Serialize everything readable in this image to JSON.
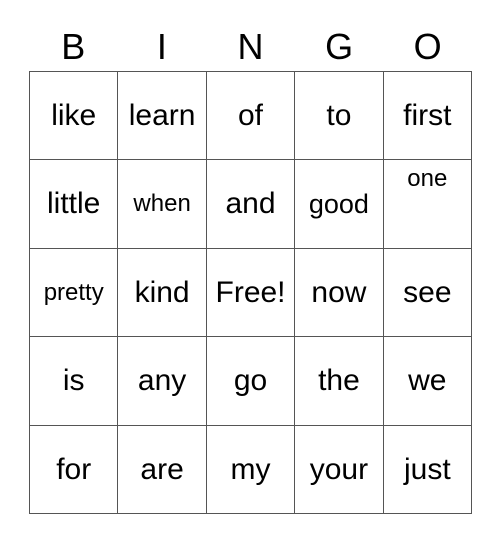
{
  "card": {
    "title": "BINGO",
    "headers": [
      "B",
      "I",
      "N",
      "G",
      "O"
    ],
    "free_space_label": "Free!",
    "grid_line_color": "#555555",
    "background_color": "#ffffff",
    "text_color": "#000000",
    "rows": 5,
    "columns": 5,
    "cells": [
      [
        {
          "text": "like",
          "size": "normal",
          "valign": "middle"
        },
        {
          "text": "learn",
          "size": "normal",
          "valign": "middle"
        },
        {
          "text": "of",
          "size": "normal",
          "valign": "middle"
        },
        {
          "text": "to",
          "size": "normal",
          "valign": "middle"
        },
        {
          "text": "first",
          "size": "normal",
          "valign": "middle"
        }
      ],
      [
        {
          "text": "little",
          "size": "normal",
          "valign": "middle"
        },
        {
          "text": "when",
          "size": "small",
          "valign": "middle"
        },
        {
          "text": "and",
          "size": "normal",
          "valign": "middle"
        },
        {
          "text": "good",
          "size": "medium",
          "valign": "middle"
        },
        {
          "text": "one",
          "size": "small",
          "valign": "top"
        }
      ],
      [
        {
          "text": "pretty",
          "size": "small",
          "valign": "middle"
        },
        {
          "text": "kind",
          "size": "normal",
          "valign": "middle"
        },
        {
          "text": "Free!",
          "size": "normal",
          "valign": "middle"
        },
        {
          "text": "now",
          "size": "normal",
          "valign": "middle"
        },
        {
          "text": "see",
          "size": "normal",
          "valign": "middle"
        }
      ],
      [
        {
          "text": "is",
          "size": "normal",
          "valign": "middle"
        },
        {
          "text": "any",
          "size": "normal",
          "valign": "middle"
        },
        {
          "text": "go",
          "size": "normal",
          "valign": "middle"
        },
        {
          "text": "the",
          "size": "normal",
          "valign": "middle"
        },
        {
          "text": "we",
          "size": "normal",
          "valign": "middle"
        }
      ],
      [
        {
          "text": "for",
          "size": "normal",
          "valign": "middle"
        },
        {
          "text": "are",
          "size": "normal",
          "valign": "middle"
        },
        {
          "text": "my",
          "size": "normal",
          "valign": "middle"
        },
        {
          "text": "your",
          "size": "normal",
          "valign": "middle"
        },
        {
          "text": "just",
          "size": "normal",
          "valign": "middle"
        }
      ]
    ]
  }
}
